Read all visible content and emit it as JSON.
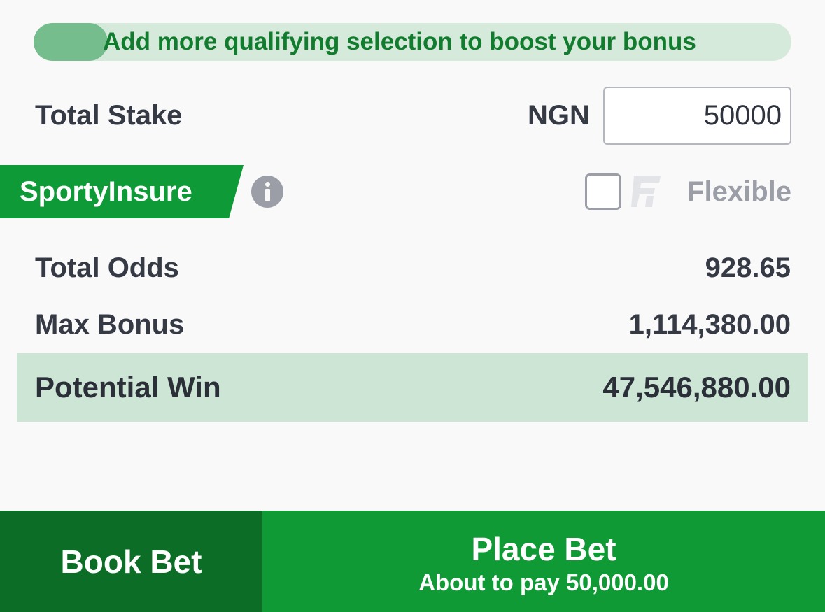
{
  "bonus_hint": {
    "text": "Add more qualifying selection to boost your bonus",
    "progress": 0.1
  },
  "stake": {
    "label": "Total Stake",
    "currency": "NGN",
    "value": "50000"
  },
  "insurance": {
    "label": "SportyInsure",
    "info_icon": "info-icon"
  },
  "flexible": {
    "label": "Flexible",
    "checked": false,
    "logo_icon": "flexible-logo-icon"
  },
  "summary": {
    "odds_label": "Total Odds",
    "odds_value": "928.65",
    "bonus_label": "Max Bonus",
    "bonus_value": "1,114,380.00",
    "win_label": "Potential Win",
    "win_value": "47,546,880.00"
  },
  "actions": {
    "book_label": "Book Bet",
    "place_label": "Place Bet",
    "place_sub": "About to pay 50,000.00"
  },
  "colors": {
    "brand_green": "#0f9a35",
    "dark_green": "#0c6d27",
    "highlight": "#cce5d5",
    "bonus_track": "#d5eadb",
    "bonus_fill": "#76bd8d"
  }
}
